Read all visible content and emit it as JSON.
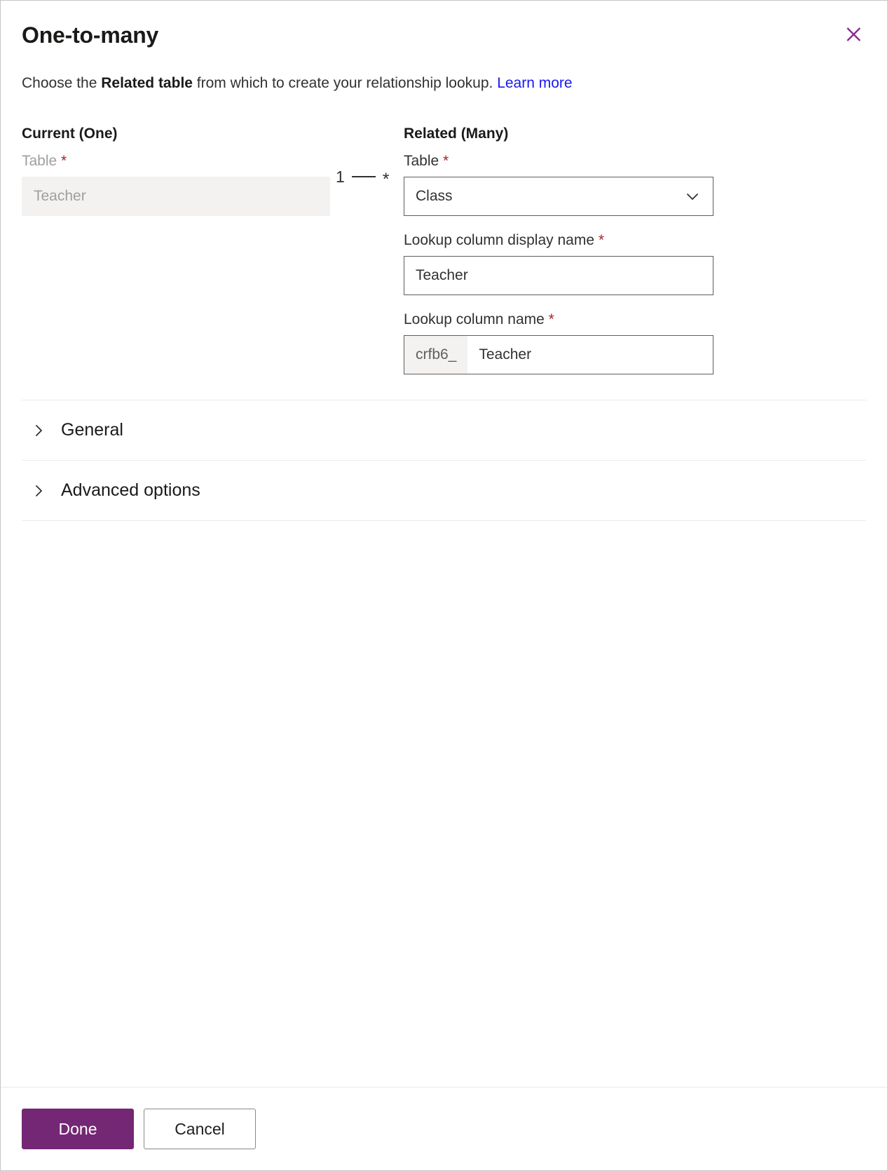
{
  "dialog": {
    "title": "One-to-many",
    "close_icon": "close-icon",
    "description": {
      "prefix": "Choose the ",
      "bold": "Related table",
      "suffix": " from which to create your relationship lookup. ",
      "link_label": "Learn more"
    }
  },
  "current": {
    "heading": "Current (One)",
    "table_label": "Table",
    "required_marker": "*",
    "table_value": "Teacher"
  },
  "connector": {
    "one": "1",
    "dash": "—",
    "many": "*"
  },
  "related": {
    "heading": "Related (Many)",
    "table_label": "Table",
    "required_marker": "*",
    "table_value": "Class",
    "table_chevron_icon": "chevron-down-icon",
    "display_name_label": "Lookup column display name",
    "display_name_value": "Teacher",
    "column_name_label": "Lookup column name",
    "column_name_prefix": "crfb6_",
    "column_name_value": "Teacher"
  },
  "accordions": [
    {
      "label": "General",
      "icon": "chevron-right-icon",
      "expanded": false
    },
    {
      "label": "Advanced options",
      "icon": "chevron-right-icon",
      "expanded": false
    }
  ],
  "footer": {
    "done_label": "Done",
    "cancel_label": "Cancel"
  },
  "colors": {
    "accent": "#742774",
    "link": "#1a1aee",
    "required": "#a4262c",
    "border": "#605e5c",
    "disabled_bg": "#f3f2f1",
    "divider": "#edebe9"
  }
}
